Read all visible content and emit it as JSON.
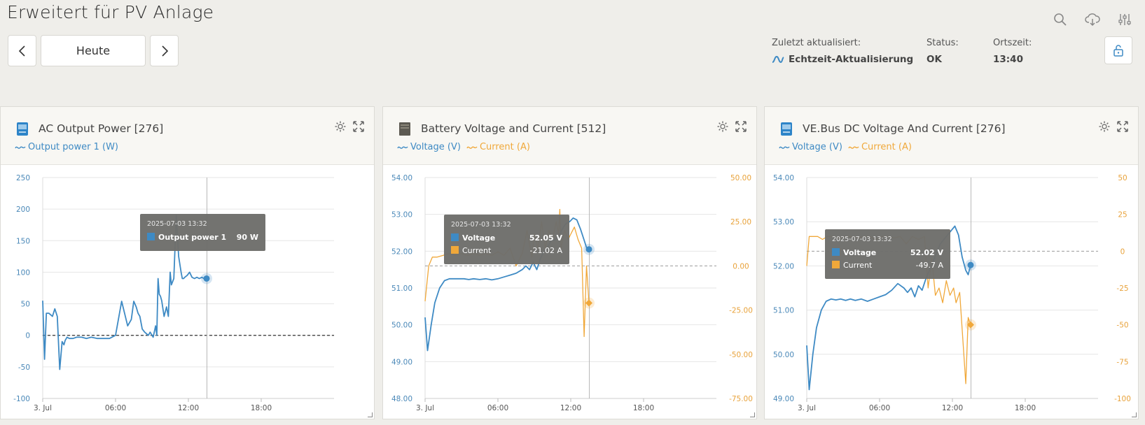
{
  "header": {
    "title": "Erweitert für PV Anlage",
    "nav": {
      "prev_icon": "chevron-left-icon",
      "period_label": "Heute",
      "next_icon": "chevron-right-icon"
    },
    "last_updated": {
      "label": "Zuletzt aktualisiert:",
      "value": "Echtzeit-Aktualisierung"
    },
    "status": {
      "label": "Status:",
      "value": "OK"
    },
    "local_time": {
      "label": "Ortszeit:",
      "value": "13:40"
    },
    "icons": [
      "search-icon",
      "cloud-download-icon",
      "sliders-icon",
      "unlock-icon"
    ]
  },
  "colors": {
    "blue": "#3e8ac4",
    "orange": "#f0a83a",
    "tooltip_bg": "#6e6e6b",
    "grid": "#e6e6e6"
  },
  "panels": [
    {
      "title": "AC Output Power [276]",
      "icon": "inverter-icon",
      "legend": [
        {
          "label": "Output power 1 (W)",
          "color": "#3e8ac4"
        }
      ],
      "tooltip": {
        "time": "2025-07-03 13:32",
        "rows": [
          {
            "label": "Output power 1",
            "value": "90 W",
            "color": "#3e8ac4"
          }
        ]
      }
    },
    {
      "title": "Battery Voltage and Current [512]",
      "icon": "battery-icon",
      "legend": [
        {
          "label": "Voltage (V)",
          "color": "#3e8ac4"
        },
        {
          "label": "Current (A)",
          "color": "#f0a83a"
        }
      ],
      "tooltip": {
        "time": "2025-07-03 13:32",
        "rows": [
          {
            "label": "Voltage",
            "value": "52.05 V",
            "color": "#3e8ac4"
          },
          {
            "label": "Current",
            "value": "-21.02 A",
            "color": "#f0a83a"
          }
        ]
      }
    },
    {
      "title": "VE.Bus DC Voltage And Current [276]",
      "icon": "inverter-icon",
      "legend": [
        {
          "label": "Voltage (V)",
          "color": "#3e8ac4"
        },
        {
          "label": "Current (A)",
          "color": "#f0a83a"
        }
      ],
      "tooltip": {
        "time": "2025-07-03 13:32",
        "rows": [
          {
            "label": "Voltage",
            "value": "52.02 V",
            "color": "#3e8ac4"
          },
          {
            "label": "Current",
            "value": "-49.7 A",
            "color": "#f0a83a"
          }
        ]
      }
    }
  ],
  "chart_data": [
    {
      "type": "line",
      "x_ticks": [
        "3. Jul",
        "06:00",
        "12:00",
        "18:00"
      ],
      "xlim_hours": [
        0,
        24
      ],
      "ylim": [
        -100,
        250
      ],
      "y_ticks": [
        "250",
        "200",
        "150",
        "100",
        "50",
        "0",
        "-50",
        "-100"
      ],
      "zero_line": 0,
      "crosshair_hour": 13.53,
      "series": [
        {
          "name": "Output power 1",
          "axis": "left",
          "color": "#3e8ac4",
          "x": [
            0,
            0.15,
            0.3,
            0.5,
            0.8,
            1.0,
            1.2,
            1.4,
            1.6,
            1.75,
            1.85,
            2.0,
            2.2,
            2.5,
            2.8,
            3.2,
            3.6,
            4.0,
            4.5,
            5.0,
            5.5,
            6.0,
            6.5,
            7.0,
            7.3,
            7.5,
            7.7,
            7.85,
            8.0,
            8.2,
            8.4,
            8.7,
            8.85,
            9.1,
            9.3,
            9.4,
            9.5,
            9.6,
            9.7,
            9.8,
            10.0,
            10.2,
            10.35,
            10.5,
            10.6,
            10.8,
            11.0,
            11.2,
            11.4,
            11.5,
            11.6,
            11.7,
            11.9,
            12.1,
            12.3,
            12.5,
            12.7,
            12.9,
            13.1,
            13.3,
            13.5
          ],
          "y": [
            55,
            -38,
            35,
            35,
            30,
            42,
            30,
            -54,
            -10,
            -15,
            -8,
            -3,
            -5,
            -5,
            -3,
            -3,
            -5,
            -3,
            -5,
            -5,
            -5,
            0,
            54,
            15,
            25,
            54,
            45,
            35,
            30,
            10,
            5,
            0,
            5,
            -3,
            15,
            0,
            90,
            65,
            62,
            55,
            30,
            45,
            30,
            100,
            80,
            90,
            190,
            125,
            100,
            90,
            90,
            92,
            95,
            100,
            92,
            90,
            92,
            90,
            92,
            90,
            90
          ]
        }
      ]
    },
    {
      "type": "line",
      "x_ticks": [
        "3. Jul",
        "06:00",
        "12:00",
        "18:00"
      ],
      "xlim_hours": [
        0,
        24
      ],
      "ylim": [
        48,
        54
      ],
      "y_ticks": [
        "54.00",
        "53.00",
        "52.00",
        "51.00",
        "50.00",
        "49.00",
        "48.00"
      ],
      "y2lim": [
        -75,
        50
      ],
      "y2_ticks": [
        "50.00",
        "25.00",
        "0.00",
        "-25.00",
        "-50.00",
        "-75.00"
      ],
      "zero_line_y2": 0,
      "crosshair_hour": 13.53,
      "series": [
        {
          "name": "Voltage",
          "axis": "left",
          "color": "#3e8ac4",
          "x": [
            0,
            0.2,
            0.5,
            0.8,
            1.2,
            1.6,
            2.0,
            2.4,
            2.8,
            3.2,
            3.6,
            4.0,
            4.5,
            5.0,
            5.5,
            6.0,
            6.5,
            7.0,
            7.5,
            8.0,
            8.3,
            8.6,
            8.9,
            9.2,
            9.5,
            9.8,
            10.1,
            10.4,
            10.7,
            11.0,
            11.3,
            11.6,
            11.9,
            12.2,
            12.5,
            12.8,
            13.1,
            13.3,
            13.5
          ],
          "y": [
            50.2,
            49.3,
            50.0,
            50.6,
            51.0,
            51.2,
            51.25,
            51.25,
            51.25,
            51.25,
            51.23,
            51.25,
            51.23,
            51.25,
            51.22,
            51.25,
            51.3,
            51.35,
            51.4,
            51.5,
            51.6,
            51.5,
            51.7,
            51.5,
            51.8,
            52.0,
            52.1,
            52.3,
            52.3,
            52.4,
            52.6,
            52.75,
            52.8,
            52.9,
            52.85,
            52.6,
            52.3,
            52.1,
            52.05
          ]
        },
        {
          "name": "Current",
          "axis": "right",
          "color": "#f0a83a",
          "x": [
            0,
            0.3,
            0.6,
            1.0,
            1.5,
            2.0,
            2.5,
            3.0,
            3.5,
            4.0,
            4.5,
            5.0,
            5.5,
            6.0,
            6.5,
            7.0,
            7.5,
            8.0,
            8.4,
            8.8,
            9.0,
            9.3,
            9.6,
            9.9,
            10.2,
            10.5,
            10.8,
            11.0,
            11.1,
            11.2,
            11.5,
            11.8,
            12.0,
            12.3,
            12.6,
            12.9,
            13.1,
            13.3,
            13.5
          ],
          "y": [
            -20,
            0,
            5,
            5,
            6,
            7,
            6,
            7,
            6,
            7,
            6,
            7,
            6,
            8,
            6,
            10,
            0,
            7,
            20,
            5,
            18,
            10,
            25,
            10,
            20,
            15,
            25,
            18,
            32,
            10,
            20,
            15,
            18,
            22,
            15,
            10,
            -40,
            0,
            -21
          ]
        }
      ]
    },
    {
      "type": "line",
      "x_ticks": [
        "3. Jul",
        "06:00",
        "12:00",
        "18:00"
      ],
      "xlim_hours": [
        0,
        24
      ],
      "ylim": [
        49,
        54
      ],
      "y_ticks": [
        "54.00",
        "53.00",
        "52.00",
        "51.00",
        "50.00",
        "49.00"
      ],
      "y2lim": [
        -100,
        50
      ],
      "y2_ticks": [
        "50",
        "25",
        "0",
        "-25",
        "-50",
        "-75",
        "-100"
      ],
      "zero_line_y2": 0,
      "crosshair_hour": 13.53,
      "series": [
        {
          "name": "Voltage",
          "axis": "left",
          "color": "#3e8ac4",
          "x": [
            0,
            0.2,
            0.5,
            0.8,
            1.2,
            1.6,
            2.0,
            2.4,
            2.8,
            3.2,
            3.6,
            4.0,
            4.5,
            5.0,
            5.5,
            6.0,
            6.5,
            7.0,
            7.5,
            8.0,
            8.3,
            8.6,
            8.9,
            9.2,
            9.5,
            9.8,
            10.1,
            10.4,
            10.7,
            11.0,
            11.3,
            11.6,
            11.9,
            12.2,
            12.5,
            12.8,
            13.1,
            13.3,
            13.5
          ],
          "y": [
            50.2,
            49.2,
            50.0,
            50.6,
            51.0,
            51.2,
            51.25,
            51.23,
            51.25,
            51.22,
            51.25,
            51.22,
            51.25,
            51.2,
            51.25,
            51.3,
            51.35,
            51.45,
            51.6,
            51.5,
            51.4,
            51.5,
            51.3,
            51.55,
            51.45,
            51.7,
            51.9,
            52.1,
            52.3,
            52.5,
            52.6,
            52.7,
            52.8,
            52.9,
            52.7,
            52.2,
            51.9,
            51.8,
            52.02
          ]
        },
        {
          "name": "Current",
          "axis": "right",
          "color": "#f0a83a",
          "x": [
            0,
            0.2,
            0.5,
            0.9,
            1.3,
            1.7,
            2.2,
            2.7,
            3.2,
            3.7,
            4.2,
            4.7,
            5.2,
            5.7,
            6.2,
            6.7,
            7.2,
            7.7,
            8.2,
            8.7,
            9.2,
            9.7,
            10.0,
            10.3,
            10.6,
            10.9,
            11.2,
            11.5,
            11.8,
            12.1,
            12.3,
            12.6,
            12.9,
            13.1,
            13.3,
            13.5
          ],
          "y": [
            -10,
            10,
            10,
            10,
            8,
            10,
            10,
            9,
            10,
            10,
            9,
            10,
            10,
            8,
            10,
            10,
            9,
            10,
            5,
            10,
            8,
            10,
            -25,
            -5,
            -30,
            -25,
            -35,
            -20,
            -30,
            -25,
            -35,
            -28,
            -65,
            -90,
            -45,
            -50
          ]
        }
      ]
    }
  ]
}
